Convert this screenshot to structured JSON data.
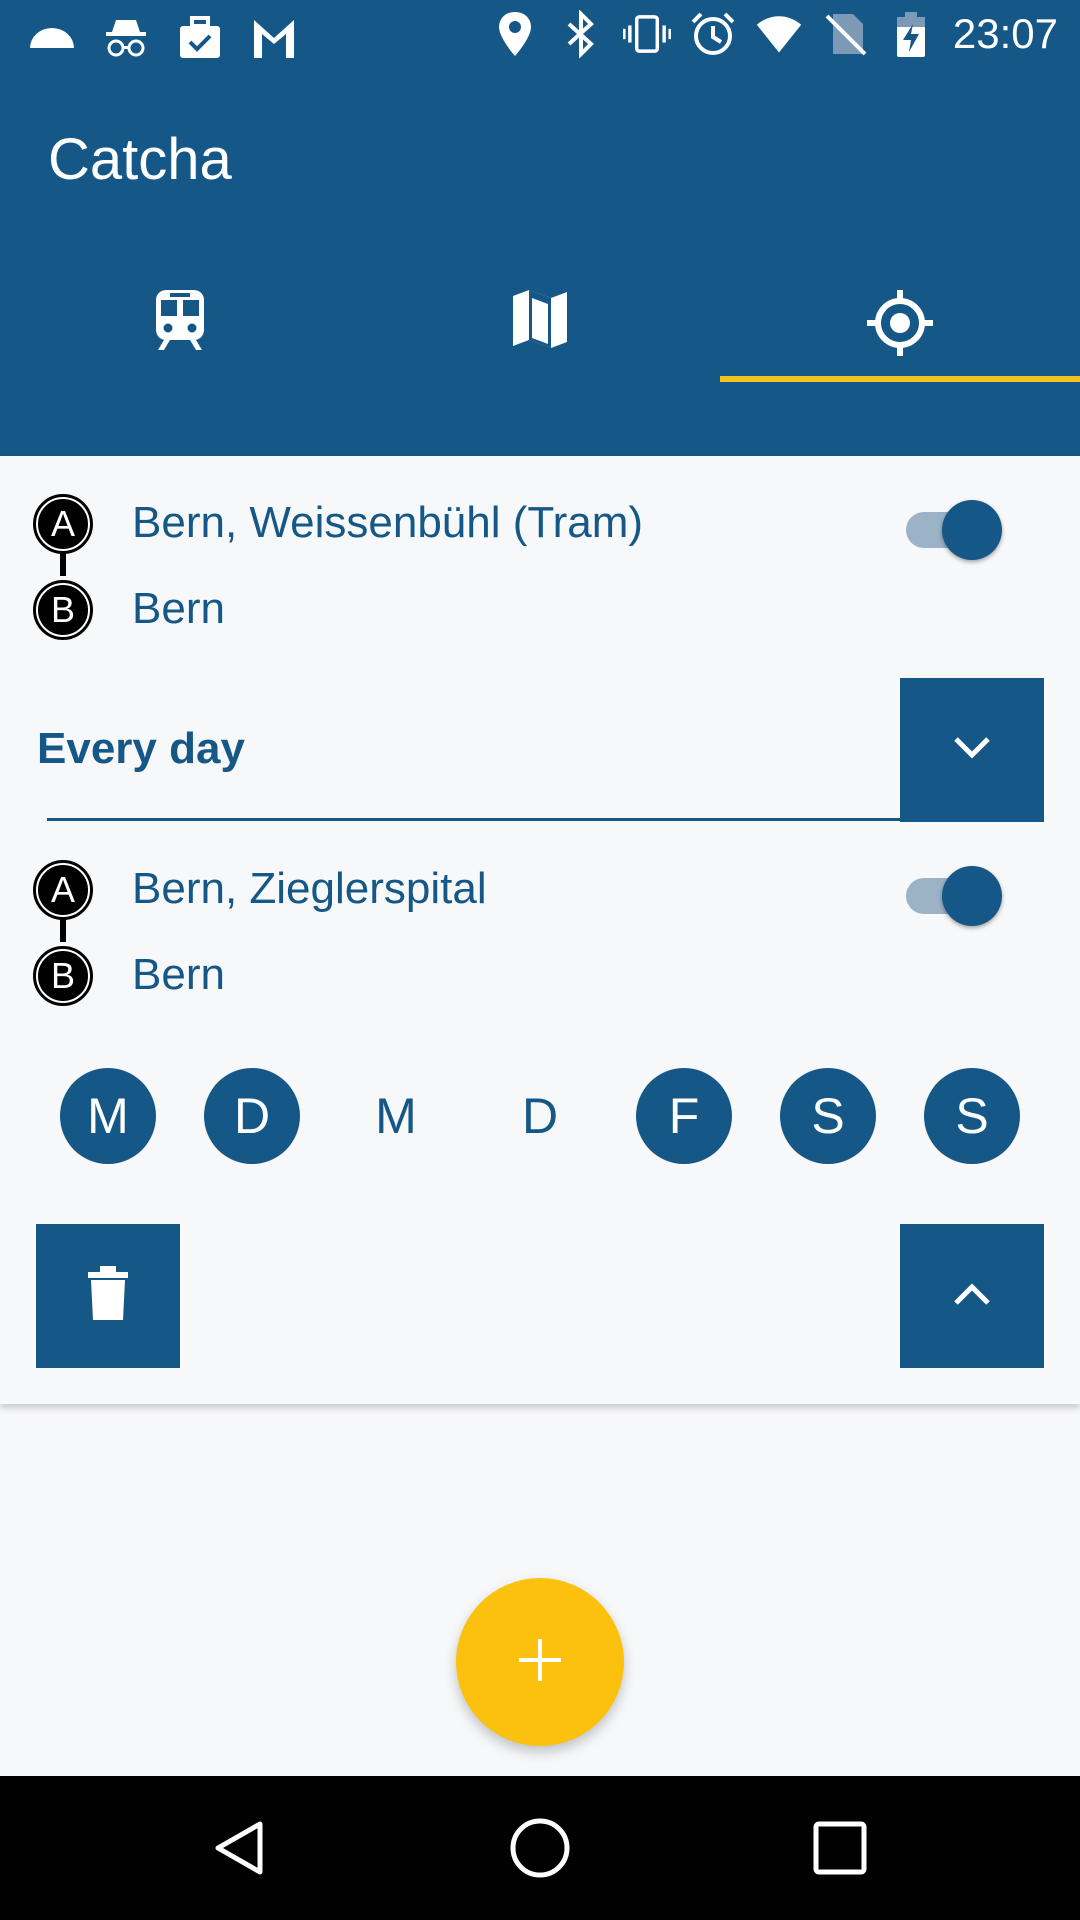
{
  "status_bar": {
    "time": "23:07",
    "left_icons": [
      "cloud-icon",
      "incognito-icon",
      "briefcase-check-icon",
      "gmail-icon"
    ],
    "right_icons": [
      "location-icon",
      "bluetooth-icon",
      "vibrate-icon",
      "alarm-icon",
      "wifi-icon",
      "no-sim-icon",
      "battery-charging-icon"
    ]
  },
  "app": {
    "title": "Catcha",
    "tabs": [
      {
        "icon": "train-icon",
        "selected": false
      },
      {
        "icon": "map-icon",
        "selected": false
      },
      {
        "icon": "location-target-icon",
        "selected": true
      }
    ],
    "accent_color": "#f4c21f",
    "primary_color": "#155787"
  },
  "routes": [
    {
      "from_badge": "A",
      "to_badge": "B",
      "from": "Bern, Weissenbühl (Tram)",
      "to": "Bern",
      "enabled": true
    },
    {
      "from_badge": "A",
      "to_badge": "B",
      "from": "Bern, Zieglerspital",
      "to": "Bern",
      "enabled": true
    }
  ],
  "schedule": {
    "selected": "Every day"
  },
  "days": [
    {
      "label": "M",
      "active": true
    },
    {
      "label": "D",
      "active": true
    },
    {
      "label": "M",
      "active": false
    },
    {
      "label": "D",
      "active": false
    },
    {
      "label": "F",
      "active": true
    },
    {
      "label": "S",
      "active": true
    },
    {
      "label": "S",
      "active": true
    }
  ],
  "actions": {
    "delete_icon": "trash-icon",
    "collapse_icon": "chevron-up-icon",
    "dropdown_icon": "chevron-down-icon",
    "fab_icon": "plus-icon"
  },
  "nav_bar": {
    "buttons": [
      "back-icon",
      "home-icon",
      "recents-icon"
    ]
  }
}
